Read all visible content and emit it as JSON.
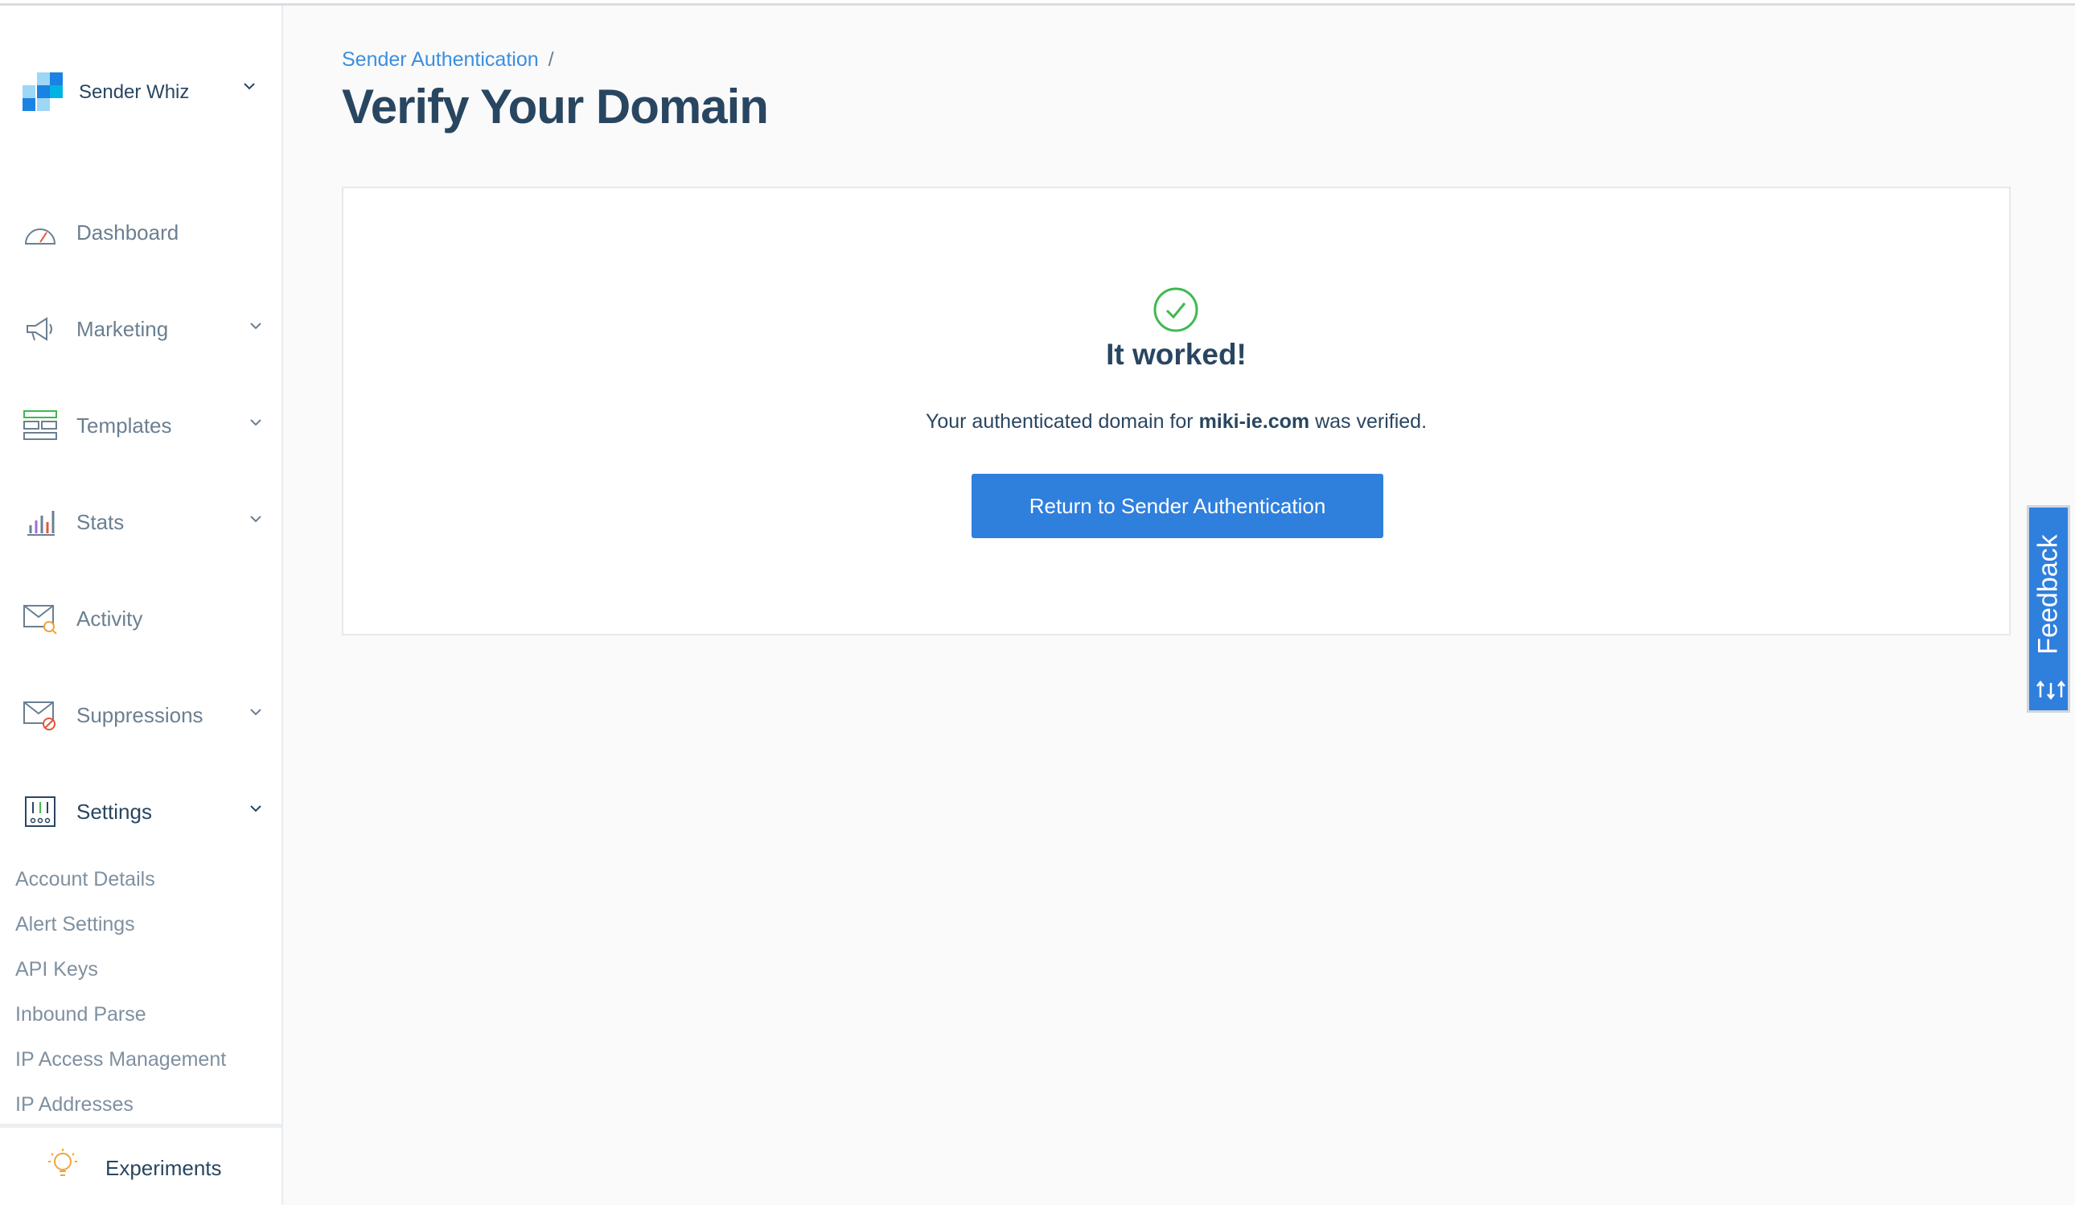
{
  "sidebar": {
    "account_name": "Sender Whiz",
    "items": [
      {
        "label": "Dashboard",
        "icon": "dashboard-gauge-icon"
      },
      {
        "label": "Marketing",
        "icon": "megaphone-icon"
      },
      {
        "label": "Templates",
        "icon": "templates-icon"
      },
      {
        "label": "Stats",
        "icon": "bar-chart-icon"
      },
      {
        "label": "Activity",
        "icon": "envelope-search-icon"
      },
      {
        "label": "Suppressions",
        "icon": "envelope-blocked-icon"
      },
      {
        "label": "Settings",
        "icon": "settings-sliders-icon"
      }
    ],
    "settings_subitems": [
      "Account Details",
      "Alert Settings",
      "API Keys",
      "Inbound Parse",
      "IP Access Management",
      "IP Addresses"
    ],
    "experiments_label": "Experiments"
  },
  "breadcrumb": {
    "link": "Sender Authentication",
    "separator": "/"
  },
  "page": {
    "title": "Verify Your Domain"
  },
  "result": {
    "title": "It worked!",
    "text_before": "Your authenticated domain for ",
    "domain": "miki-ie.com",
    "text_after": " was verified.",
    "button_label": "Return to Sender Authentication"
  },
  "feedback": {
    "label": "Feedback"
  },
  "colors": {
    "accent": "#2f7fdd",
    "success": "#3fb950",
    "text": "#294661"
  }
}
